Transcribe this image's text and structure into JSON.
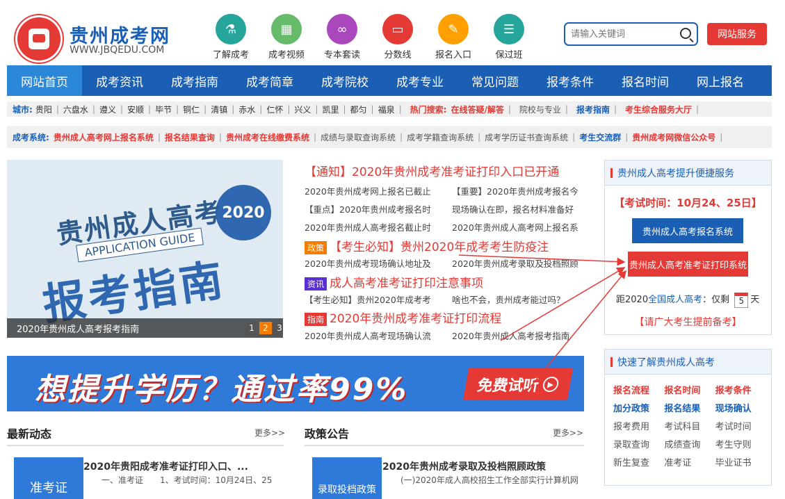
{
  "brand": {
    "title": "贵州成考网",
    "sub": "WWW.JBQEDU.COM"
  },
  "quick_links": [
    {
      "label": "了解成考",
      "color": "#26a69a",
      "icon": "flask-icon",
      "glyph": "⚗"
    },
    {
      "label": "成考视频",
      "color": "#66bb6a",
      "icon": "building-icon",
      "glyph": "▦"
    },
    {
      "label": "专本套读",
      "color": "#ab47bc",
      "icon": "binoculars-icon",
      "glyph": "∞"
    },
    {
      "label": "分数线",
      "color": "#e53935",
      "icon": "laptop-icon",
      "glyph": "▭"
    },
    {
      "label": "报名入口",
      "color": "#ffa000",
      "icon": "pen-icon",
      "glyph": "✎"
    },
    {
      "label": "保过班",
      "color": "#26a69a",
      "icon": "clipboard-icon",
      "glyph": "☰"
    }
  ],
  "search": {
    "placeholder": "请输入关键词"
  },
  "service_button": "网站服务",
  "nav": [
    "网站首页",
    "成考资讯",
    "成考指南",
    "成考简章",
    "成考院校",
    "成考专业",
    "常见问题",
    "报考条件",
    "报名时间",
    "网上报名"
  ],
  "city_strip": {
    "label": "城市:",
    "cities": [
      "贵阳",
      "六盘水",
      "遵义",
      "安顺",
      "毕节",
      "铜仁",
      "清镇",
      "赤水",
      "仁怀",
      "兴义",
      "凯里",
      "都匀",
      "福泉"
    ],
    "hot_label": "热门搜索:",
    "hot": [
      {
        "t": "在线答疑/解答",
        "c": "red"
      },
      {
        "t": "院校与专业",
        "c": "gry"
      },
      {
        "t": "报考指南",
        "c": "blu"
      },
      {
        "t": "考生综合服务大厅",
        "c": "red"
      }
    ]
  },
  "system_strip": {
    "label": "成考系统:",
    "items": [
      {
        "t": "贵州成人高考网上报名系统",
        "c": "red"
      },
      {
        "t": "报名结果查询",
        "c": "red"
      },
      {
        "t": "贵州成考在线缴费系统",
        "c": "red"
      },
      {
        "t": "成绩与录取查询系统",
        "c": "gry"
      },
      {
        "t": "成考学籍查询系统",
        "c": "gry"
      },
      {
        "t": "成考学历证书查询系统",
        "c": "gry"
      },
      {
        "t": "考生交流群",
        "c": "blu"
      },
      {
        "t": "贵州成考网微信公众号",
        "c": "red"
      }
    ]
  },
  "slider": {
    "line1": "贵州成人高考",
    "line2": "APPLICATION GUIDE",
    "line3": "报考指南",
    "badge": "2020",
    "caption": "2020年贵州成人高考报考指南",
    "pages": [
      "1",
      "2",
      "3"
    ]
  },
  "news": {
    "h1": "【通知】2020年贵州成考准考证打印入口已开通",
    "r1": [
      "2020年贵州成考网上报名已截止",
      "【重要】2020年贵州成考报名今"
    ],
    "r2": [
      "【重点】2020年贵州成考报名时",
      "现场确认在即，报名材料准备好"
    ],
    "r3": [
      "2020年贵州成人高考报名截止时",
      "2020年贵州成人高考网上报名系"
    ],
    "h2_tag": "政策",
    "h2": "【考生必知】贵州2020年成考考生防疫注",
    "r4": [
      "2020年贵州成考现场确认地址及",
      "2020年贵州成考录取及投档照顾"
    ],
    "h3_tag": "资讯",
    "h3": "成人高考准考证打印注意事项",
    "r5": [
      "【考生必知】贵州2020年成考考",
      "啥也不会，贵州成考能过吗？"
    ],
    "h4_tag": "指南",
    "h4": "2020年贵州成考准考证打印流程",
    "r6": [
      "2020年贵州成人高考现场确认流",
      "2020年贵州成人高考报考指南"
    ],
    "tag_colors": {
      "政策": "#f57c00",
      "资讯": "#5b2fd6",
      "指南": "#e53935"
    }
  },
  "service_box": {
    "title": "贵州成人高考提升便捷服务",
    "exam_time": "【考试时间：10月24、25日】",
    "btn1": "贵州成人高考报名系统",
    "btn2": "贵州成人高考准考证打印系统",
    "countdown_pre": "距2020",
    "countdown_link": "全国成人高考",
    "countdown_mid": "：仅剩",
    "days": "5",
    "countdown_post": "天",
    "reminder": "【请广大考生提前备考】"
  },
  "big_banner": {
    "text": "想提升学历？通过率99%",
    "button": "免费试听"
  },
  "quick_box": {
    "title": "快速了解贵州成人高考",
    "items": [
      {
        "t": "报名流程",
        "c": "#e53935",
        "b": true
      },
      {
        "t": "报名时间",
        "c": "#e53935",
        "b": true
      },
      {
        "t": "报考条件",
        "c": "#e53935",
        "b": true
      },
      {
        "t": "加分政策",
        "c": "#1a5fb4",
        "b": true
      },
      {
        "t": "报名结果",
        "c": "#1a5fb4",
        "b": true
      },
      {
        "t": "现场确认",
        "c": "#1a5fb4",
        "b": true
      },
      {
        "t": "报考费用",
        "c": "#555",
        "b": false
      },
      {
        "t": "考试科目",
        "c": "#555",
        "b": false
      },
      {
        "t": "考试时间",
        "c": "#555",
        "b": false
      },
      {
        "t": "录取查询",
        "c": "#555",
        "b": false
      },
      {
        "t": "成绩查询",
        "c": "#555",
        "b": false
      },
      {
        "t": "考生守则",
        "c": "#555",
        "b": false
      },
      {
        "t": "新生复查",
        "c": "#555",
        "b": false
      },
      {
        "t": "准考证",
        "c": "#555",
        "b": false
      },
      {
        "t": "毕业证书",
        "c": "#555",
        "b": false
      }
    ]
  },
  "latest": {
    "title": "最新动态",
    "more": "更多>>",
    "item_title": "2020年贵阳成考准考证打印入口、...",
    "item_desc": "一、准考证　　1、考试时间：10月24日、25",
    "thumb": "准考证"
  },
  "policy": {
    "title": "政策公告",
    "more": "更多>>",
    "item_title": "2020年贵州成考录取及投档照顾政策",
    "item_desc": "(一)2020年成人高校招生工作全部实行计算机网",
    "thumb": "录取投档政策"
  }
}
